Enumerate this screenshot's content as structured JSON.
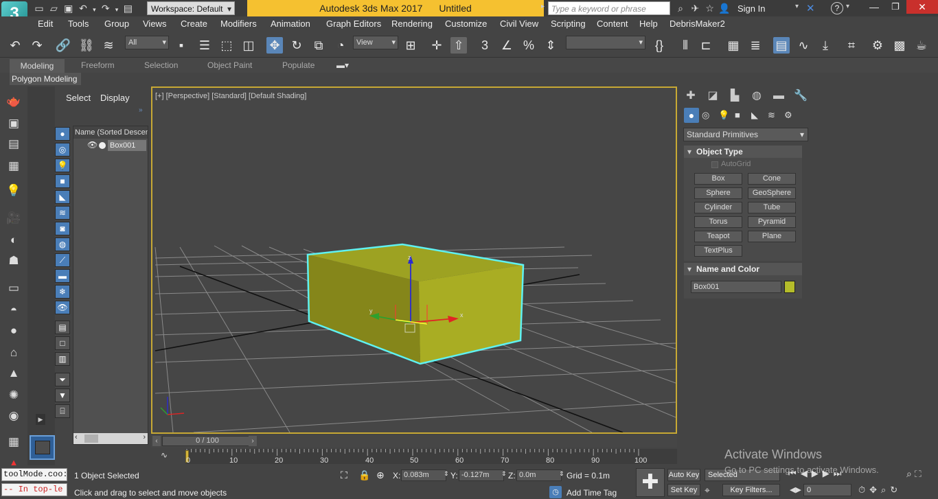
{
  "title": {
    "app": "Autodesk 3ds Max 2017",
    "document": "Untitled",
    "workspace": "Workspace: Default",
    "search_placeholder": "Type a keyword or phrase",
    "sign_in": "Sign In"
  },
  "menu": [
    "Edit",
    "Tools",
    "Group",
    "Views",
    "Create",
    "Modifiers",
    "Animation",
    "Graph Editors",
    "Rendering",
    "Customize",
    "Civil View",
    "Scripting",
    "Content",
    "Help",
    "DebrisMaker2"
  ],
  "toolbar": {
    "selection_filter": "All",
    "ref_coord": "View",
    "named_selection": ""
  },
  "ribbon": {
    "tabs": [
      "Modeling",
      "Freeform",
      "Selection",
      "Object Paint",
      "Populate"
    ],
    "active_panel": "Polygon Modeling"
  },
  "explorer": {
    "tabs": [
      "Select",
      "Display"
    ],
    "column_header": "Name (Sorted Descen",
    "items": [
      "Box001"
    ]
  },
  "viewport": {
    "label": "[+] [Perspective] [Standard] [Default Shading]",
    "gizmo_x": "x",
    "gizmo_y": "y",
    "gizmo_z": "z",
    "object_color": "#a8a824",
    "selection_color": "#5ff2f2"
  },
  "time": {
    "slider": "0 / 100",
    "ticks": [
      "0",
      "10",
      "20",
      "30",
      "40",
      "50",
      "60",
      "70",
      "80",
      "90",
      "100"
    ]
  },
  "command_panel": {
    "category": "Standard Primitives",
    "object_type_title": "Object Type",
    "autogrid": "AutoGrid",
    "buttons": [
      "Box",
      "Cone",
      "Sphere",
      "GeoSphere",
      "Cylinder",
      "Tube",
      "Torus",
      "Pyramid",
      "Teapot",
      "Plane",
      "TextPlus"
    ],
    "name_color_title": "Name and Color",
    "object_name": "Box001",
    "object_color": "#b5bc2a"
  },
  "status": {
    "maxscript_1": "toolMode.coo:",
    "maxscript_2": "--  In top-le",
    "selection_info": "1 Object Selected",
    "prompt": "Click and drag to select and move objects",
    "x_label": "X:",
    "x_value": "0.083m",
    "y_label": "Y:",
    "y_value": "-0.127m",
    "z_label": "Z:",
    "z_value": "0.0m",
    "grid": "Grid = 0.1m",
    "add_time_tag": "Add Time Tag",
    "auto_key": "Auto Key",
    "set_key": "Set Key",
    "selected": "Selected",
    "key_filters": "Key Filters...",
    "frame": "0"
  },
  "watermark": {
    "line1": "Activate Windows",
    "line2": "Go to PC settings to activate Windows."
  }
}
